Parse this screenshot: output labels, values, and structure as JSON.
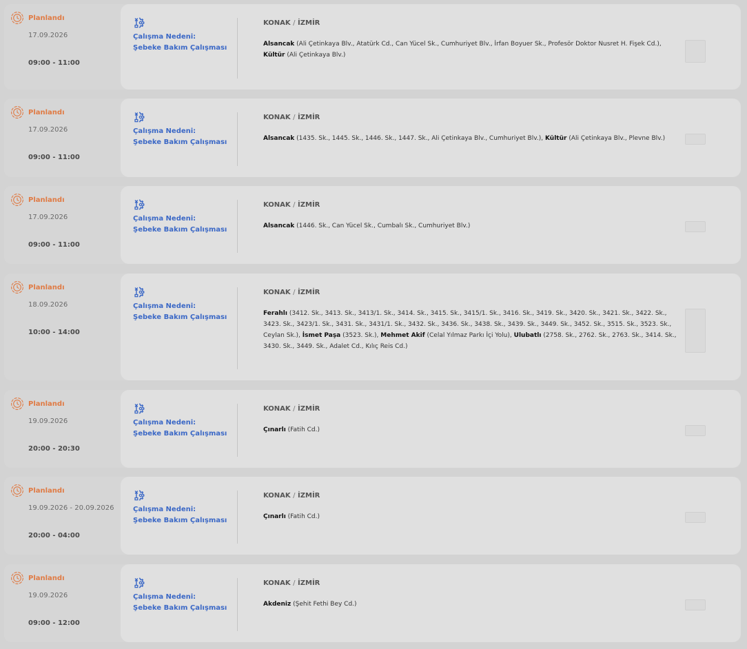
{
  "outages": [
    {
      "status": "Planlandı",
      "date": "17.09.2026",
      "time": "09:00 - 11:00",
      "reason_label": "Çalışma Nedeni:",
      "reason": "Şebeke Bakım Çalışması",
      "district": "KONAK",
      "separator": "/",
      "city": "İZMİR",
      "areas": [
        {
          "name": "Alsancak",
          "streets": "(Ali Çetinkaya Blv., Atatürk Cd., Can Yücel Sk., Cumhuriyet Blv., İrfan Boyuer Sk., Profesör Doktor Nusret H. Fişek Cd.),"
        },
        {
          "name": "Kültür",
          "streets": "(Ali Çetinkaya Blv.)"
        }
      ]
    },
    {
      "status": "Planlandı",
      "date": "17.09.2026",
      "time": "09:00 - 11:00",
      "reason_label": "Çalışma Nedeni:",
      "reason": "Şebeke Bakım Çalışması",
      "district": "KONAK",
      "separator": "/",
      "city": "İZMİR",
      "areas": [
        {
          "name": "Alsancak",
          "streets": "(1435. Sk., 1445. Sk., 1446. Sk., 1447. Sk., Ali Çetinkaya Blv., Cumhuriyet Blv.),"
        },
        {
          "name": "Kültür",
          "streets": "(Ali Çetinkaya Blv., Plevne Blv.)"
        }
      ]
    },
    {
      "status": "Planlandı",
      "date": "17.09.2026",
      "time": "09:00 - 11:00",
      "reason_label": "Çalışma Nedeni:",
      "reason": "Şebeke Bakım Çalışması",
      "district": "KONAK",
      "separator": "/",
      "city": "İZMİR",
      "areas": [
        {
          "name": "Alsancak",
          "streets": "(1446. Sk., Can Yücel Sk., Cumbalı Sk., Cumhuriyet Blv.)"
        }
      ]
    },
    {
      "status": "Planlandı",
      "date": "18.09.2026",
      "time": "10:00 - 14:00",
      "reason_label": "Çalışma Nedeni:",
      "reason": "Şebeke Bakım Çalışması",
      "district": "KONAK",
      "separator": "/",
      "city": "İZMİR",
      "areas": [
        {
          "name": "Ferahlı",
          "streets": "(3412. Sk., 3413. Sk., 3413/1. Sk., 3414. Sk., 3415. Sk., 3415/1. Sk., 3416. Sk., 3419. Sk., 3420. Sk., 3421. Sk., 3422. Sk., 3423. Sk., 3423/1. Sk., 3431. Sk., 3431/1. Sk., 3432. Sk., 3436. Sk., 3438. Sk., 3439. Sk., 3449. Sk., 3452. Sk., 3515. Sk., 3523. Sk., Ceylan Sk.),"
        },
        {
          "name": "İsmet Paşa",
          "streets": "(3523. Sk.),"
        },
        {
          "name": "Mehmet Akif",
          "streets": "(Celal Yılmaz Parkı İçi Yolu),"
        },
        {
          "name": "Ulubatlı",
          "streets": "(2758. Sk., 2762. Sk., 2763. Sk., 3414. Sk., 3430. Sk., 3449. Sk., Adalet Cd., Kılıç Reis Cd.)"
        }
      ]
    },
    {
      "status": "Planlandı",
      "date": "19.09.2026",
      "time": "20:00 - 20:30",
      "reason_label": "Çalışma Nedeni:",
      "reason": "Şebeke Bakım Çalışması",
      "district": "KONAK",
      "separator": "/",
      "city": "İZMİR",
      "areas": [
        {
          "name": "Çınarlı",
          "streets": "(Fatih Cd.)"
        }
      ]
    },
    {
      "status": "Planlandı",
      "date": "19.09.2026 - 20.09.2026",
      "time": "20:00 - 04:00",
      "reason_label": "Çalışma Nedeni:",
      "reason": "Şebeke Bakım Çalışması",
      "district": "KONAK",
      "separator": "/",
      "city": "İZMİR",
      "areas": [
        {
          "name": "Çınarlı",
          "streets": "(Fatih Cd.)"
        }
      ]
    },
    {
      "status": "Planlandı",
      "date": "19.09.2026",
      "time": "09:00 - 12:00",
      "reason_label": "Çalışma Nedeni:",
      "reason": "Şebeke Bakım Çalışması",
      "district": "KONAK",
      "separator": "/",
      "city": "İZMİR",
      "areas": [
        {
          "name": "Akdeniz",
          "streets": "(Şehit Fethi Bey Cd.)"
        }
      ]
    }
  ],
  "colors": {
    "status": "#e07a43",
    "reason": "#3b68c6"
  },
  "icons": {
    "status": "planned-status-icon",
    "reason": "maintenance-gear-icon"
  }
}
